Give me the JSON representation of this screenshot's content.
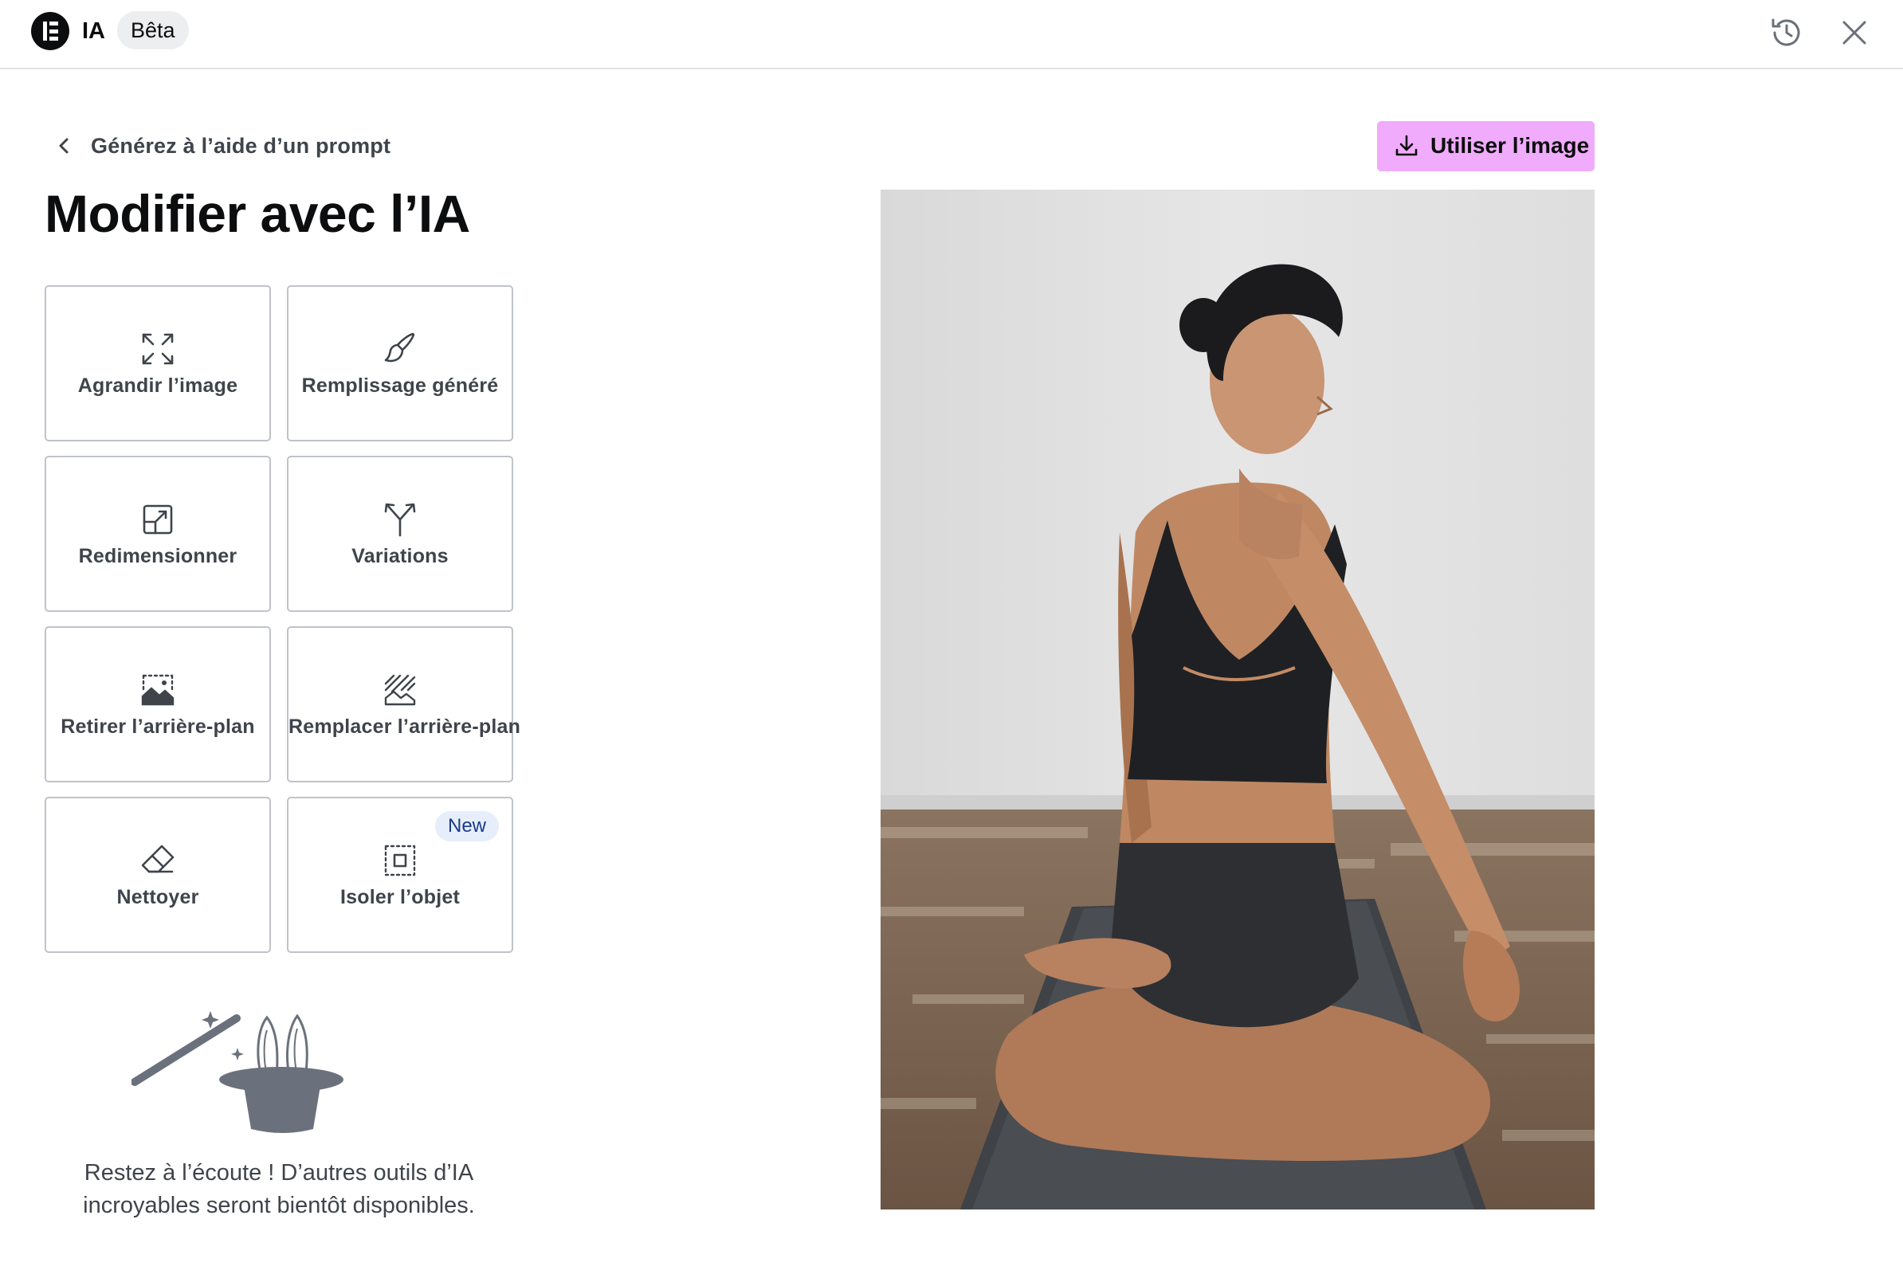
{
  "header": {
    "app_title": "IA",
    "badge": "Bêta",
    "history_icon": "history-icon",
    "close_icon": "close-icon"
  },
  "nav": {
    "back_label": "Générez à l’aide d’un prompt",
    "back_icon": "chevron-left-icon"
  },
  "page": {
    "title": "Modifier avec l’IA"
  },
  "tools": [
    {
      "label": "Agrandir l’image",
      "icon": "expand-icon"
    },
    {
      "label": "Remplissage généré",
      "icon": "brush-icon"
    },
    {
      "label": "Redimensionner",
      "icon": "resize-icon"
    },
    {
      "label": "Variations",
      "icon": "split-arrows-icon"
    },
    {
      "label": "Retirer l’arrière-plan",
      "icon": "remove-background-icon"
    },
    {
      "label": "Remplacer l’arrière-plan",
      "icon": "replace-background-icon"
    },
    {
      "label": "Nettoyer",
      "icon": "eraser-icon"
    },
    {
      "label": "Isoler l’objet",
      "icon": "isolate-object-icon",
      "badge": "New"
    }
  ],
  "info": {
    "illustration": "magic-hat-illustration",
    "text": "Restez à l’écoute ! D’autres outils d’IA incroyables seront bientôt disponibles."
  },
  "actions": {
    "use_image_label": "Utiliser l’image",
    "use_image_icon": "download-icon"
  },
  "colors": {
    "accent": "#f0abfc",
    "badge_new_bg": "#e6eefb",
    "badge_new_text": "#1b3a8a",
    "border": "#bfc3c9",
    "text": "#3f444b"
  }
}
